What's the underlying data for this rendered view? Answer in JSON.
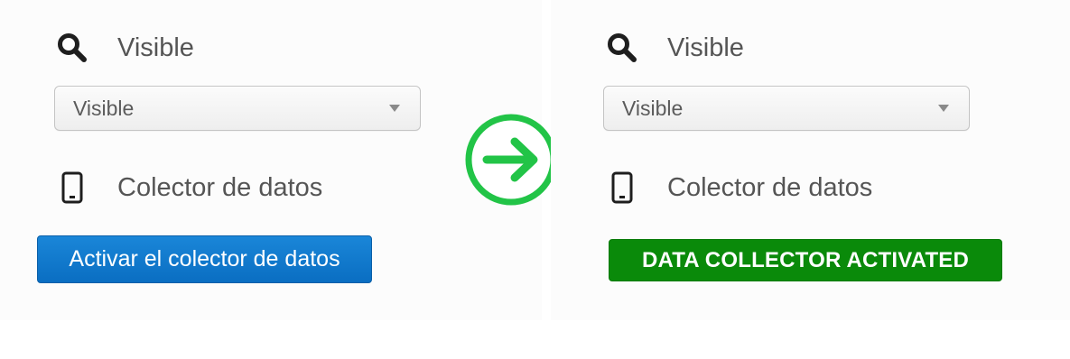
{
  "before": {
    "visibility_heading": "Visible",
    "visibility_select_value": "Visible",
    "collector_heading": "Colector de datos",
    "activate_button_label": "Activar el colector de datos"
  },
  "after": {
    "visibility_heading": "Visible",
    "visibility_select_value": "Visible",
    "collector_heading": "Colector de datos",
    "activated_badge_label": "DATA COLLECTOR ACTIVATED"
  },
  "icons": {
    "search": "search-icon",
    "device": "mobile-phone-icon",
    "transition": "arrow-right-circle-icon"
  },
  "colors": {
    "activate_button": "#0a6ec2",
    "activated_badge": "#0a8a0a",
    "transition_arrow": "#22c447"
  }
}
